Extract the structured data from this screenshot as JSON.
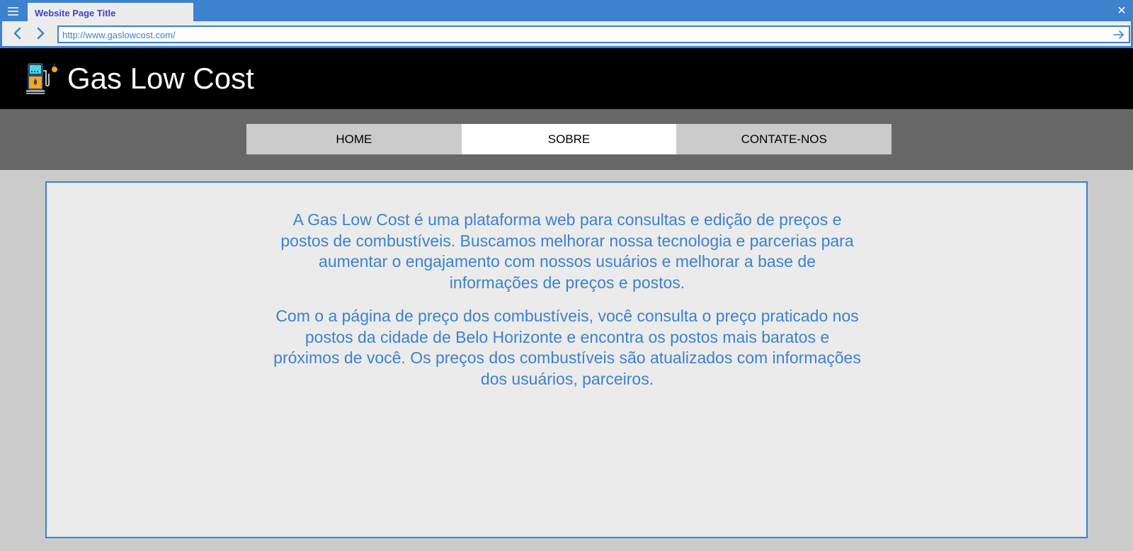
{
  "browser": {
    "tab_title": "Website Page Title",
    "url": "http://www.gaslowcost.com/",
    "close_symbol": "✕"
  },
  "site": {
    "title": "Gas Low Cost",
    "logo_icon": "gas-pump-icon"
  },
  "nav": {
    "items": [
      {
        "label": "HOME",
        "active": false
      },
      {
        "label": "SOBRE",
        "active": true
      },
      {
        "label": "CONTATE-NOS",
        "active": false
      }
    ]
  },
  "content": {
    "paragraph1": "A Gas Low Cost é uma plataforma web para consultas e edição de preços e postos de combustíveis. Buscamos melhorar nossa tecnologia e parcerias para aumentar o engajamento com nossos usuários e melhorar a base de informações de preços e postos.",
    "paragraph2": "Com o a página de preço dos combustíveis, você consulta o preço praticado nos postos da cidade de Belo Horizonte e encontra os postos mais baratos e próximos de você. Os preços dos combustíveis são atualizados com informações dos usuários, parceiros."
  },
  "colors": {
    "accent": "#3c82cd",
    "header_bg": "#000000",
    "nav_band_bg": "#676767",
    "page_bg": "#cbcbcb",
    "content_bg": "#ebebeb",
    "text": "#3c82cd"
  }
}
